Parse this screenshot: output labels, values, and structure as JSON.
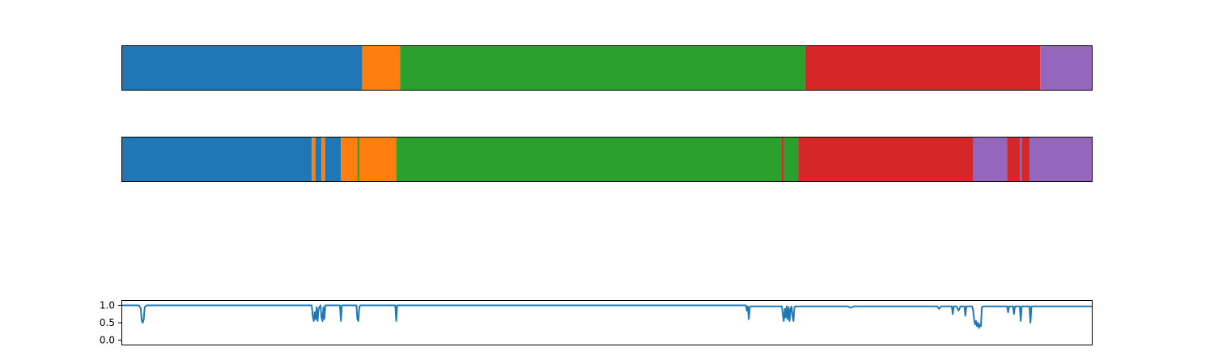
{
  "chart_data": [
    {
      "type": "segmentation-bar",
      "title": "",
      "x_range": [
        0,
        1000
      ],
      "segments": [
        {
          "start": 0,
          "end": 248,
          "color": "#1f77b4"
        },
        {
          "start": 248,
          "end": 287,
          "color": "#ff7f0e"
        },
        {
          "start": 287,
          "end": 704,
          "color": "#2ca02c"
        },
        {
          "start": 704,
          "end": 946,
          "color": "#d62728"
        },
        {
          "start": 946,
          "end": 1000,
          "color": "#9467bd"
        }
      ]
    },
    {
      "type": "segmentation-bar",
      "title": "",
      "x_range": [
        0,
        1000
      ],
      "segments": [
        {
          "start": 0,
          "end": 196,
          "color": "#1f77b4"
        },
        {
          "start": 196,
          "end": 200,
          "color": "#ff7f0e"
        },
        {
          "start": 200,
          "end": 206,
          "color": "#1f77b4"
        },
        {
          "start": 206,
          "end": 210,
          "color": "#ff7f0e"
        },
        {
          "start": 210,
          "end": 226,
          "color": "#1f77b4"
        },
        {
          "start": 226,
          "end": 243,
          "color": "#ff7f0e"
        },
        {
          "start": 243,
          "end": 245,
          "color": "#2ca02c"
        },
        {
          "start": 245,
          "end": 283,
          "color": "#ff7f0e"
        },
        {
          "start": 283,
          "end": 680,
          "color": "#2ca02c"
        },
        {
          "start": 680,
          "end": 682,
          "color": "#d62728"
        },
        {
          "start": 682,
          "end": 697,
          "color": "#2ca02c"
        },
        {
          "start": 697,
          "end": 877,
          "color": "#d62728"
        },
        {
          "start": 877,
          "end": 912,
          "color": "#9467bd"
        },
        {
          "start": 912,
          "end": 925,
          "color": "#d62728"
        },
        {
          "start": 925,
          "end": 927,
          "color": "#9467bd"
        },
        {
          "start": 927,
          "end": 935,
          "color": "#d62728"
        },
        {
          "start": 935,
          "end": 1000,
          "color": "#9467bd"
        }
      ]
    },
    {
      "type": "line",
      "title": "",
      "xlabel": "",
      "ylabel": "",
      "x_range": [
        0,
        1000
      ],
      "ylim": [
        -0.15,
        1.15
      ],
      "yticks": [
        0.0,
        0.5,
        1.0
      ],
      "ytick_labels": [
        "0.0",
        "0.5",
        "1.0"
      ],
      "grid": false,
      "series": [
        {
          "color": "#1f77b4",
          "points": [
            [
              0,
              1.0
            ],
            [
              18,
              1.0
            ],
            [
              20,
              0.9
            ],
            [
              21,
              0.55
            ],
            [
              22,
              0.5
            ],
            [
              23,
              0.6
            ],
            [
              24,
              0.95
            ],
            [
              26,
              1.0
            ],
            [
              196,
              1.0
            ],
            [
              197,
              0.7
            ],
            [
              198,
              0.55
            ],
            [
              199,
              0.8
            ],
            [
              200,
              0.6
            ],
            [
              201,
              0.95
            ],
            [
              202,
              0.55
            ],
            [
              203,
              0.9
            ],
            [
              205,
              1.0
            ],
            [
              206,
              0.65
            ],
            [
              207,
              0.55
            ],
            [
              208,
              0.95
            ],
            [
              209,
              0.6
            ],
            [
              210,
              1.0
            ],
            [
              225,
              1.0
            ],
            [
              226,
              0.55
            ],
            [
              227,
              1.0
            ],
            [
              242,
              1.0
            ],
            [
              243,
              0.6
            ],
            [
              244,
              0.55
            ],
            [
              245,
              0.95
            ],
            [
              246,
              1.0
            ],
            [
              282,
              1.0
            ],
            [
              283,
              0.55
            ],
            [
              284,
              1.0
            ],
            [
              643,
              1.0
            ],
            [
              644,
              0.85
            ],
            [
              645,
              0.97
            ],
            [
              646,
              0.6
            ],
            [
              647,
              0.95
            ],
            [
              648,
              0.97
            ],
            [
              680,
              0.97
            ],
            [
              681,
              0.75
            ],
            [
              682,
              0.55
            ],
            [
              683,
              0.9
            ],
            [
              684,
              0.65
            ],
            [
              685,
              0.97
            ],
            [
              686,
              0.6
            ],
            [
              687,
              0.95
            ],
            [
              688,
              0.55
            ],
            [
              689,
              0.9
            ],
            [
              690,
              0.97
            ],
            [
              691,
              0.7
            ],
            [
              692,
              0.55
            ],
            [
              693,
              0.95
            ],
            [
              694,
              0.97
            ],
            [
              748,
              0.97
            ],
            [
              751,
              0.93
            ],
            [
              754,
              0.97
            ],
            [
              840,
              0.97
            ],
            [
              842,
              0.9
            ],
            [
              844,
              0.97
            ],
            [
              855,
              0.97
            ],
            [
              856,
              0.75
            ],
            [
              857,
              0.97
            ],
            [
              860,
              0.97
            ],
            [
              862,
              0.85
            ],
            [
              864,
              0.97
            ],
            [
              868,
              0.97
            ],
            [
              869,
              0.7
            ],
            [
              870,
              0.97
            ],
            [
              876,
              0.97
            ],
            [
              877,
              0.85
            ],
            [
              878,
              0.6
            ],
            [
              879,
              0.45
            ],
            [
              880,
              0.55
            ],
            [
              881,
              0.4
            ],
            [
              882,
              0.5
            ],
            [
              883,
              0.35
            ],
            [
              884,
              0.45
            ],
            [
              885,
              0.4
            ],
            [
              886,
              0.95
            ],
            [
              888,
              0.97
            ],
            [
              912,
              0.97
            ],
            [
              913,
              0.8
            ],
            [
              914,
              0.97
            ],
            [
              918,
              0.97
            ],
            [
              919,
              0.75
            ],
            [
              920,
              0.97
            ],
            [
              925,
              0.97
            ],
            [
              926,
              0.55
            ],
            [
              927,
              0.97
            ],
            [
              935,
              0.97
            ],
            [
              936,
              0.5
            ],
            [
              937,
              0.97
            ],
            [
              1000,
              0.97
            ]
          ]
        }
      ]
    }
  ]
}
